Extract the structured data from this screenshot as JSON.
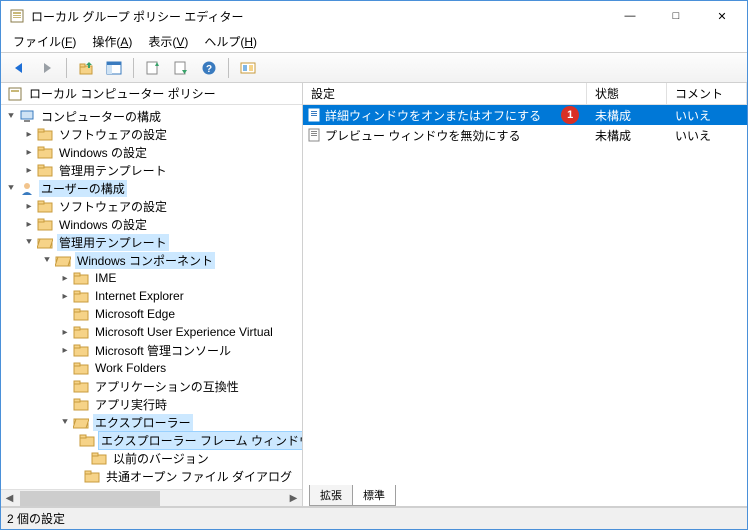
{
  "window": {
    "title": "ローカル グループ ポリシー エディター",
    "minimize": "—",
    "maximize": "□",
    "close": "✕"
  },
  "menu": {
    "file": "ファイル(F)",
    "action": "操作(A)",
    "view": "表示(V)",
    "help": "ヘルプ(H)"
  },
  "toolbar_icons": {
    "back": "back-arrow",
    "forward": "forward-arrow",
    "up": "up-folder",
    "props": "properties-pane",
    "refresh": "refresh",
    "export": "export-list",
    "help": "help",
    "filter": "filter-options"
  },
  "tree": {
    "root_label": "ローカル コンピューター ポリシー",
    "computer_config": "コンピューターの構成",
    "software_settings": "ソフトウェアの設定",
    "windows_settings": "Windows の設定",
    "admin_templates": "管理用テンプレート",
    "user_config": "ユーザーの構成",
    "windows_components": "Windows コンポーネント",
    "ime": "IME",
    "ie": "Internet Explorer",
    "edge": "Microsoft Edge",
    "muev": "Microsoft User Experience Virtual",
    "mgmt_console": "Microsoft 管理コンソール",
    "work_folders": "Work Folders",
    "app_compat": "アプリケーションの互換性",
    "app_runtime": "アプリ実行時",
    "explorer": "エクスプローラー",
    "explorer_frame": "エクスプローラー フレーム ウィンドウ",
    "previous_versions": "以前のバージョン",
    "common_open_dialog": "共通オープン ファイル ダイアログ"
  },
  "list": {
    "headers": {
      "setting": "設定",
      "state": "状態",
      "comment": "コメント"
    },
    "rows": [
      {
        "label": "詳細ウィンドウをオンまたはオフにする",
        "state": "未構成",
        "comment": "いいえ",
        "selected": true,
        "badge": "1"
      },
      {
        "label": "プレビュー ウィンドウを無効にする",
        "state": "未構成",
        "comment": "いいえ",
        "selected": false
      }
    ]
  },
  "tabs": {
    "extended": "拡張",
    "standard": "標準"
  },
  "status": "2 個の設定"
}
